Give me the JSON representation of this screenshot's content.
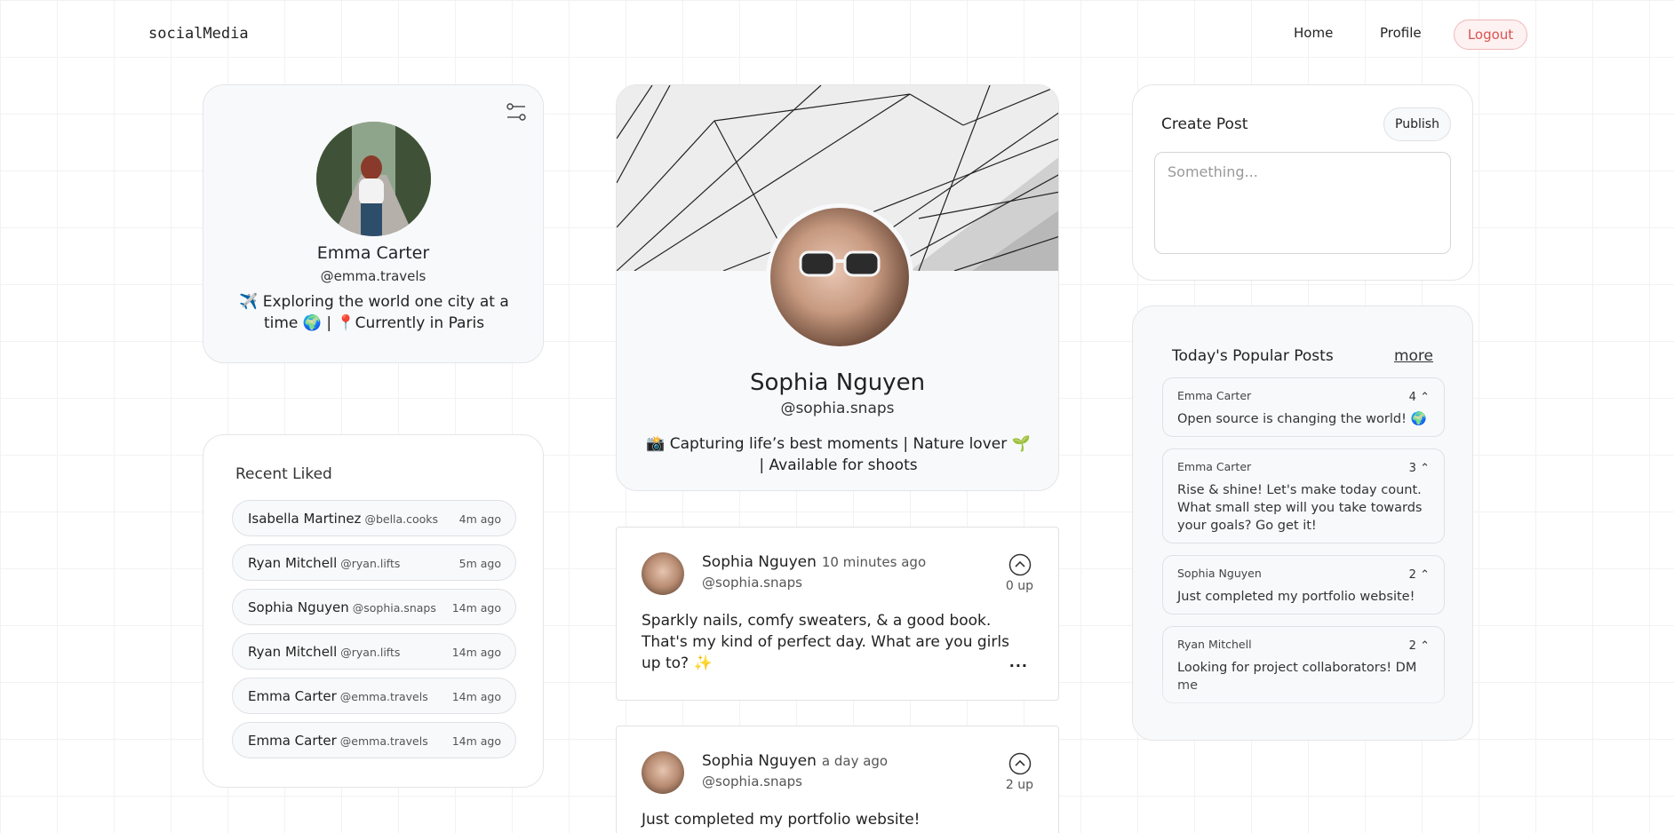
{
  "nav": {
    "brand": "socialMedia",
    "home": "Home",
    "profile": "Profile",
    "logout": "Logout"
  },
  "profile": {
    "name": "Emma Carter",
    "handle": "@emma.travels",
    "bio": "✈️ Exploring the world one city at a time 🌍 | 📍Currently in Paris"
  },
  "recent_liked": {
    "title": "Recent Liked",
    "items": [
      {
        "name": "Isabella Martinez",
        "handle": "@bella.cooks",
        "time": "4m ago"
      },
      {
        "name": "Ryan Mitchell",
        "handle": "@ryan.lifts",
        "time": "5m ago"
      },
      {
        "name": "Sophia Nguyen",
        "handle": "@sophia.snaps",
        "time": "14m ago"
      },
      {
        "name": "Ryan Mitchell",
        "handle": "@ryan.lifts",
        "time": "14m ago"
      },
      {
        "name": "Emma Carter",
        "handle": "@emma.travels",
        "time": "14m ago"
      },
      {
        "name": "Emma Carter",
        "handle": "@emma.travels",
        "time": "14m ago"
      }
    ]
  },
  "viewed_profile": {
    "name": "Sophia Nguyen",
    "handle": "@sophia.snaps",
    "bio": "📸 Capturing life’s best moments | Nature lover 🌱 | Available for shoots"
  },
  "posts": [
    {
      "author": "Sophia Nguyen",
      "time": "10 minutes ago",
      "handle": "@sophia.snaps",
      "upvotes": "0 up",
      "text": "Sparkly nails, comfy sweaters, & a good book. That's my kind of perfect day. What are you girls up to? ✨",
      "more": "···"
    },
    {
      "author": "Sophia Nguyen",
      "time": "a day ago",
      "handle": "@sophia.snaps",
      "upvotes": "2 up",
      "text": "Just completed my portfolio website!"
    }
  ],
  "create_post": {
    "title": "Create Post",
    "publish": "Publish",
    "placeholder": "Something..."
  },
  "popular": {
    "title": "Today's Popular Posts",
    "more": "more",
    "items": [
      {
        "author": "Emma Carter",
        "count": "4",
        "text": "Open source is changing the world! 🌍"
      },
      {
        "author": "Emma Carter",
        "count": "3",
        "text": "Rise & shine! Let's make today count. What small step will you take towards your goals? Go get it!"
      },
      {
        "author": "Sophia Nguyen",
        "count": "2",
        "text": "Just completed my portfolio website!"
      },
      {
        "author": "Ryan Mitchell",
        "count": "2",
        "text": "Looking for project collaborators! DM me"
      }
    ]
  },
  "colors": {
    "logout": "#d9534f",
    "card_bg": "#f8f9fb",
    "border": "#e3e5e8"
  }
}
